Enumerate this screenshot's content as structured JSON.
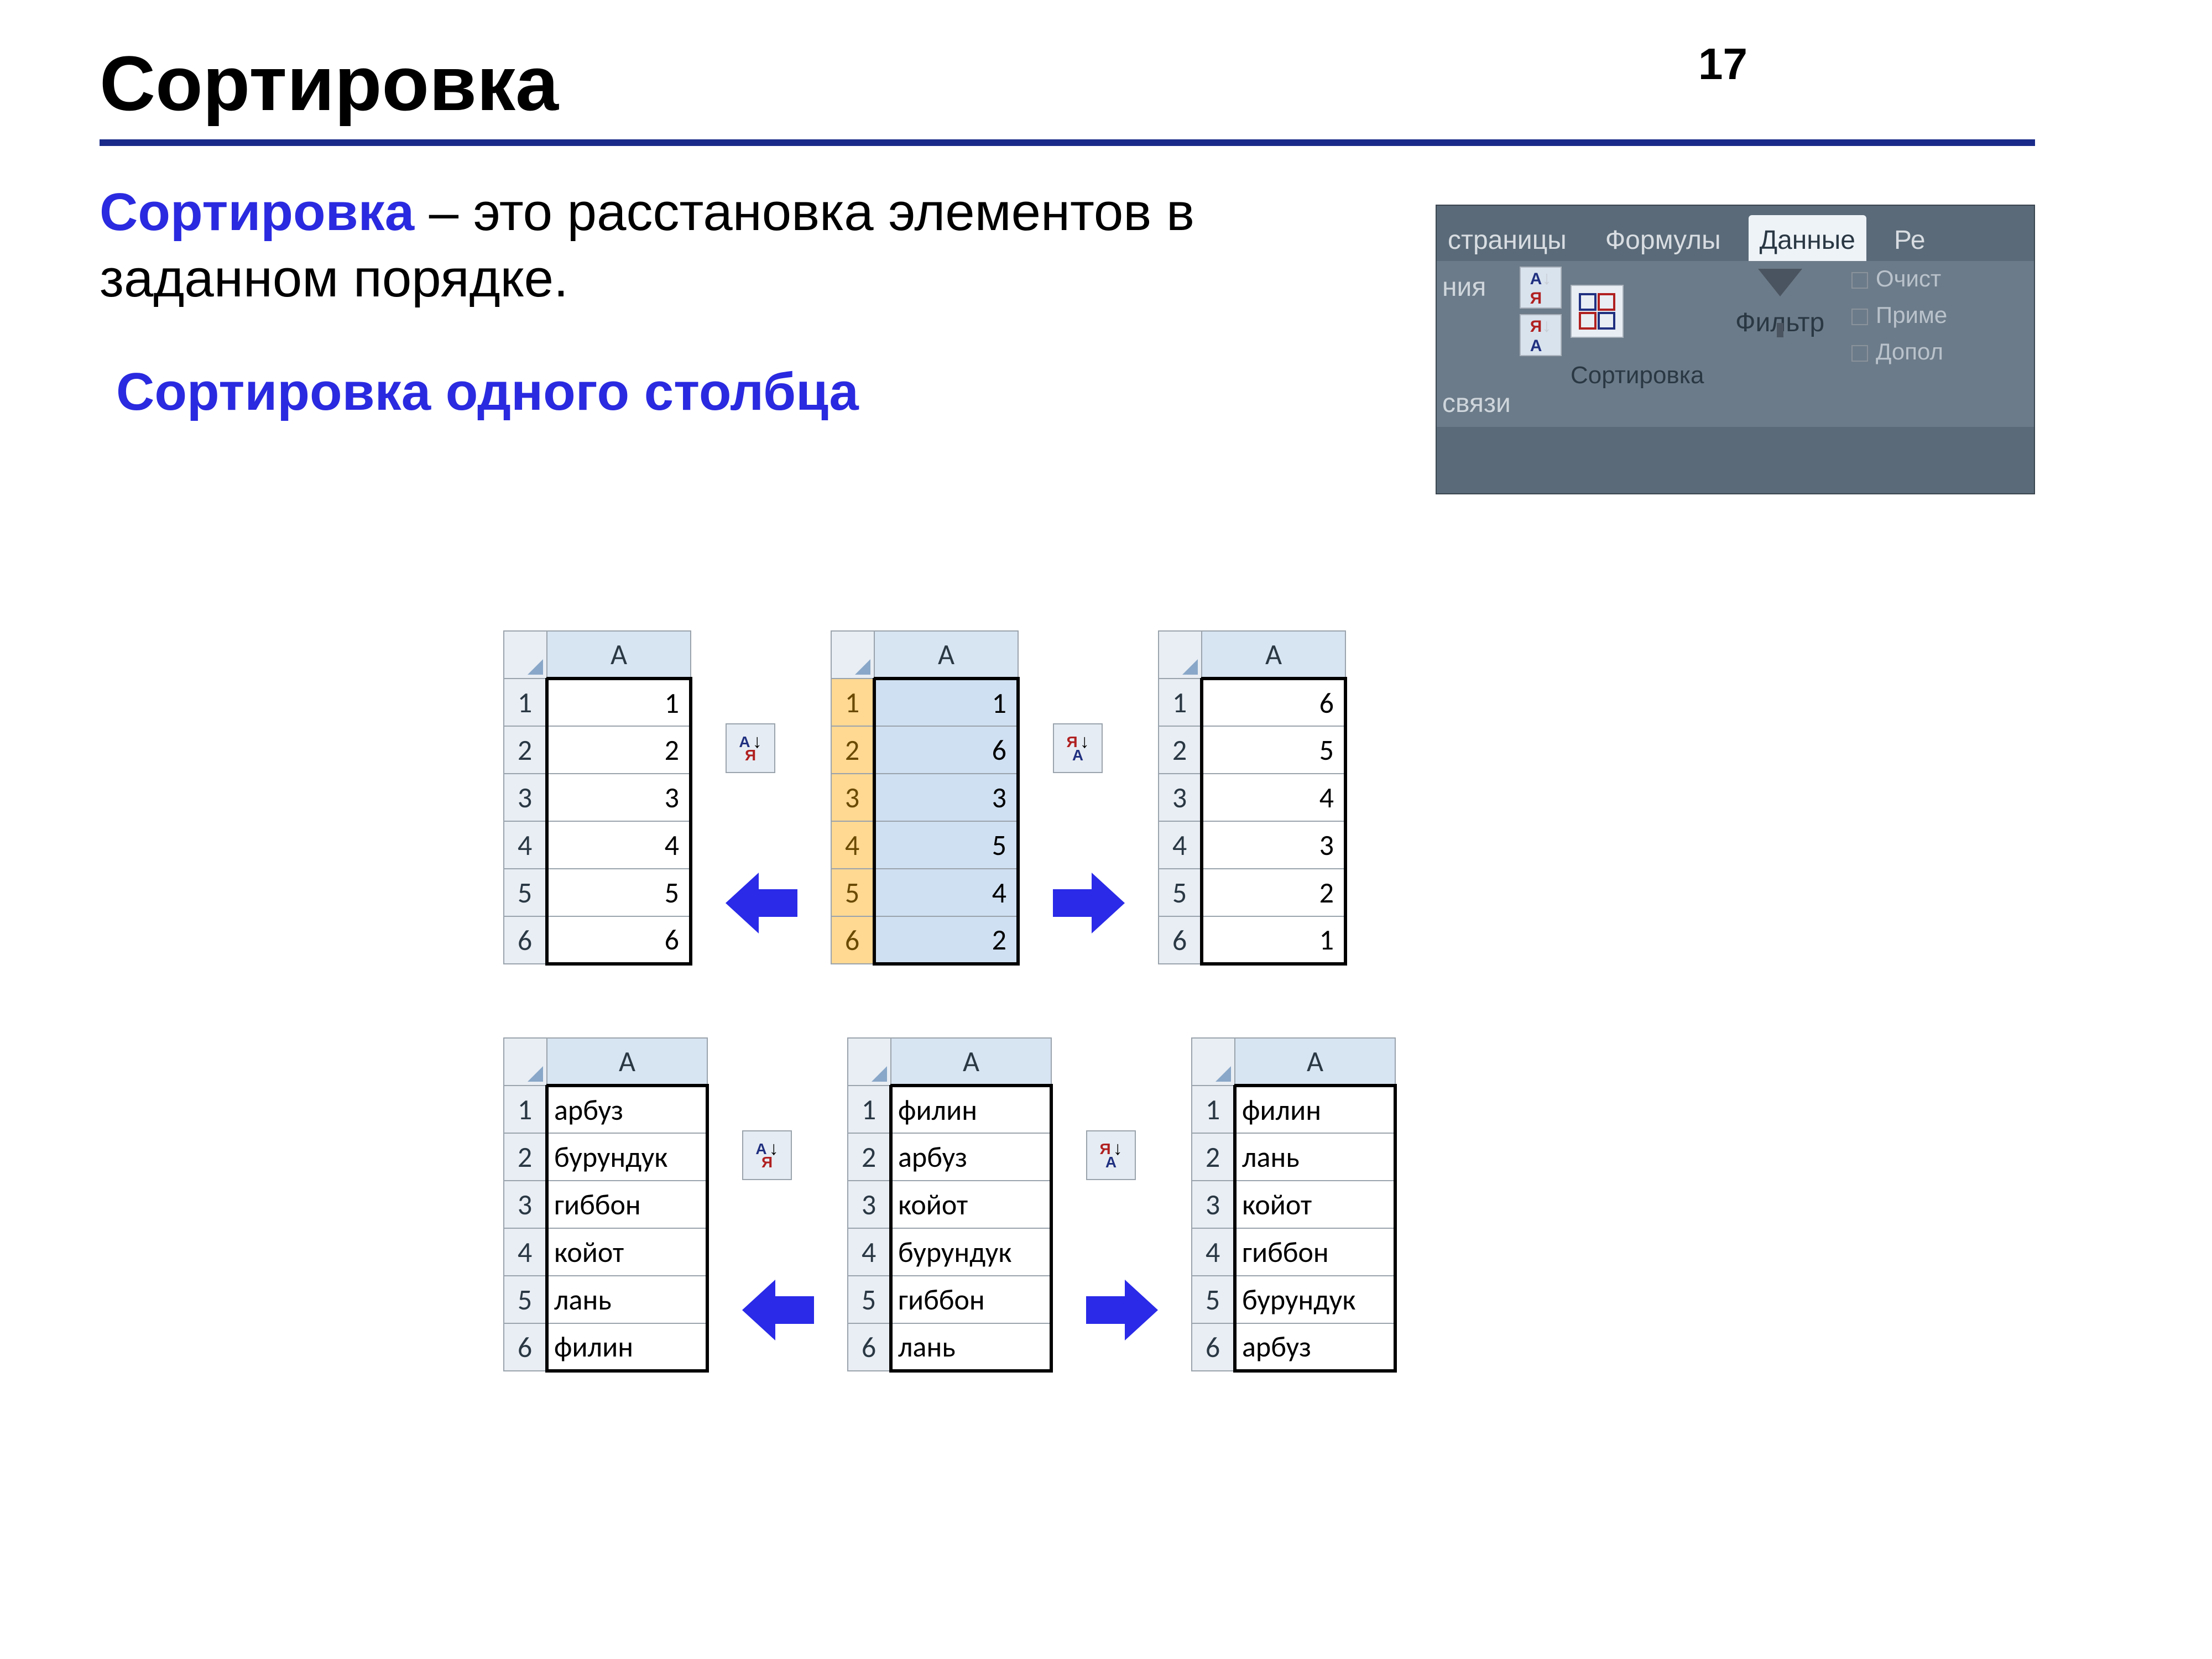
{
  "page_number": "17",
  "title": "Сортировка",
  "intro": {
    "keyword": "Сортировка",
    "rest": " – это расстановка элементов в заданном порядке."
  },
  "section_heading": "Сортировка одного столбца",
  "ribbon": {
    "tabs": {
      "t1": "страницы",
      "t2": "Формулы",
      "t3_active": "Данные",
      "t4": "Ре"
    },
    "left_top": "ния",
    "left_bottom": "связи",
    "sort_label": "Сортировка",
    "filter_label": "Фильтр",
    "actions": {
      "a1": "Очист",
      "a2": "Приме",
      "a3": "Допол"
    }
  },
  "col_letter": "A",
  "rows": [
    "1",
    "2",
    "3",
    "4",
    "5",
    "6"
  ],
  "numeric": {
    "left": [
      "1",
      "2",
      "3",
      "4",
      "5",
      "6"
    ],
    "center": [
      "1",
      "6",
      "3",
      "5",
      "4",
      "2"
    ],
    "right": [
      "6",
      "5",
      "4",
      "3",
      "2",
      "1"
    ]
  },
  "words": {
    "left": [
      "арбуз",
      "бурундук",
      "гиббон",
      "койот",
      "лань",
      "филин"
    ],
    "center": [
      "филин",
      "арбуз",
      "койот",
      "бурундук",
      "гиббон",
      "лань"
    ],
    "right": [
      "филин",
      "лань",
      "койот",
      "гиббон",
      "бурундук",
      "арбуз"
    ]
  },
  "sort_asc_letters": {
    "top": "А",
    "bottom": "Я"
  },
  "sort_desc_letters": {
    "top": "Я",
    "bottom": "А"
  }
}
